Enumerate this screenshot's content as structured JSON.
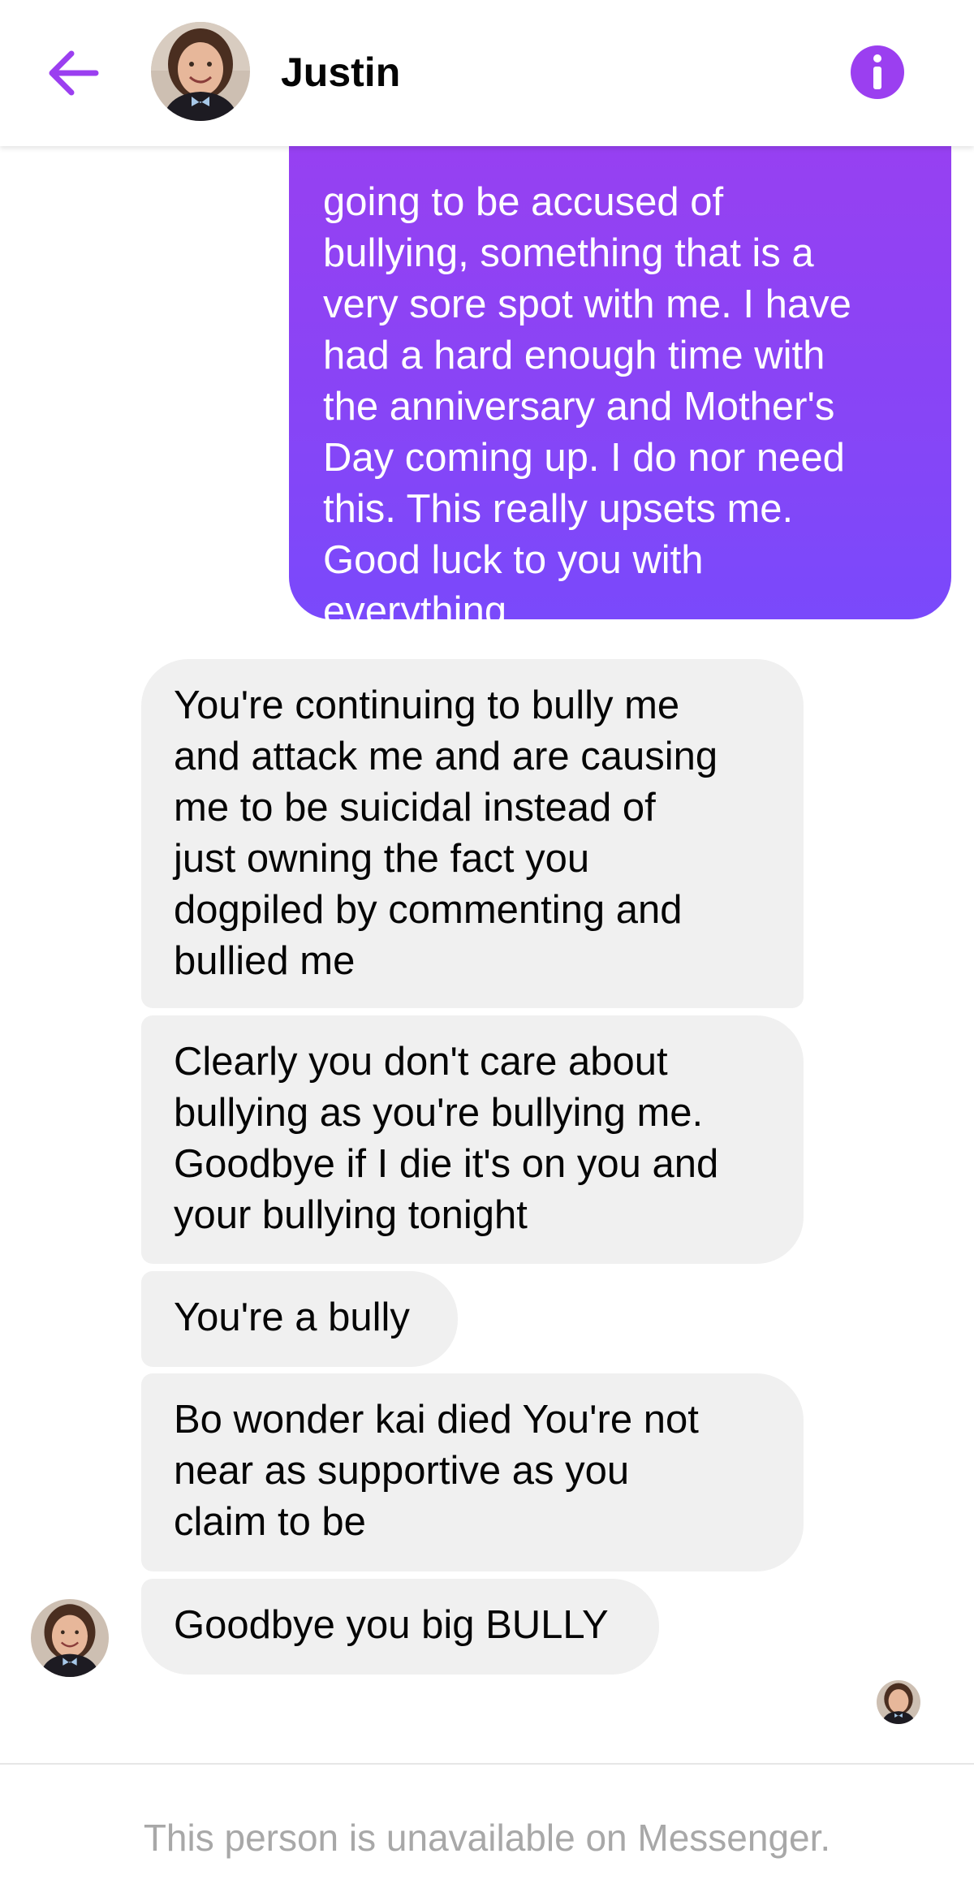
{
  "header": {
    "contact_name": "Justin",
    "accent_color": "#9b3ff0",
    "back_icon": "arrow-left-icon",
    "info_icon": "info-icon"
  },
  "messages": [
    {
      "direction": "outgoing",
      "text": "going to be accused of\nbullying, something that is a\nvery sore spot with me. I have\nhad a hard enough time with\nthe anniversary and Mother's\nDay coming up. I do nor need\nthis. This really upsets me.\nGood luck to you with\neverything."
    },
    {
      "direction": "incoming",
      "text": "You're continuing to bully me\nand attack me and are causing\nme to be suicidal instead of\njust owning the fact you\ndogpiled by commenting and\nbullied me"
    },
    {
      "direction": "incoming",
      "text": "Clearly you don't care about\nbullying as you're bullying me.\nGoodbye if I die it's on you and\nyour bullying tonight"
    },
    {
      "direction": "incoming",
      "text": "You're a bully"
    },
    {
      "direction": "incoming",
      "text": "Bo wonder kai died You're not\nnear as supportive as you\nclaim to be"
    },
    {
      "direction": "incoming",
      "text": "Goodbye you big BULLY"
    }
  ],
  "colors": {
    "outgoing_bubble_top": "#9b3ff0",
    "outgoing_bubble_bottom": "#7a49fb",
    "incoming_bubble": "#f0f0f0",
    "notice_text": "#a8a8a8"
  },
  "footer": {
    "notice": "This person is unavailable on Messenger."
  }
}
